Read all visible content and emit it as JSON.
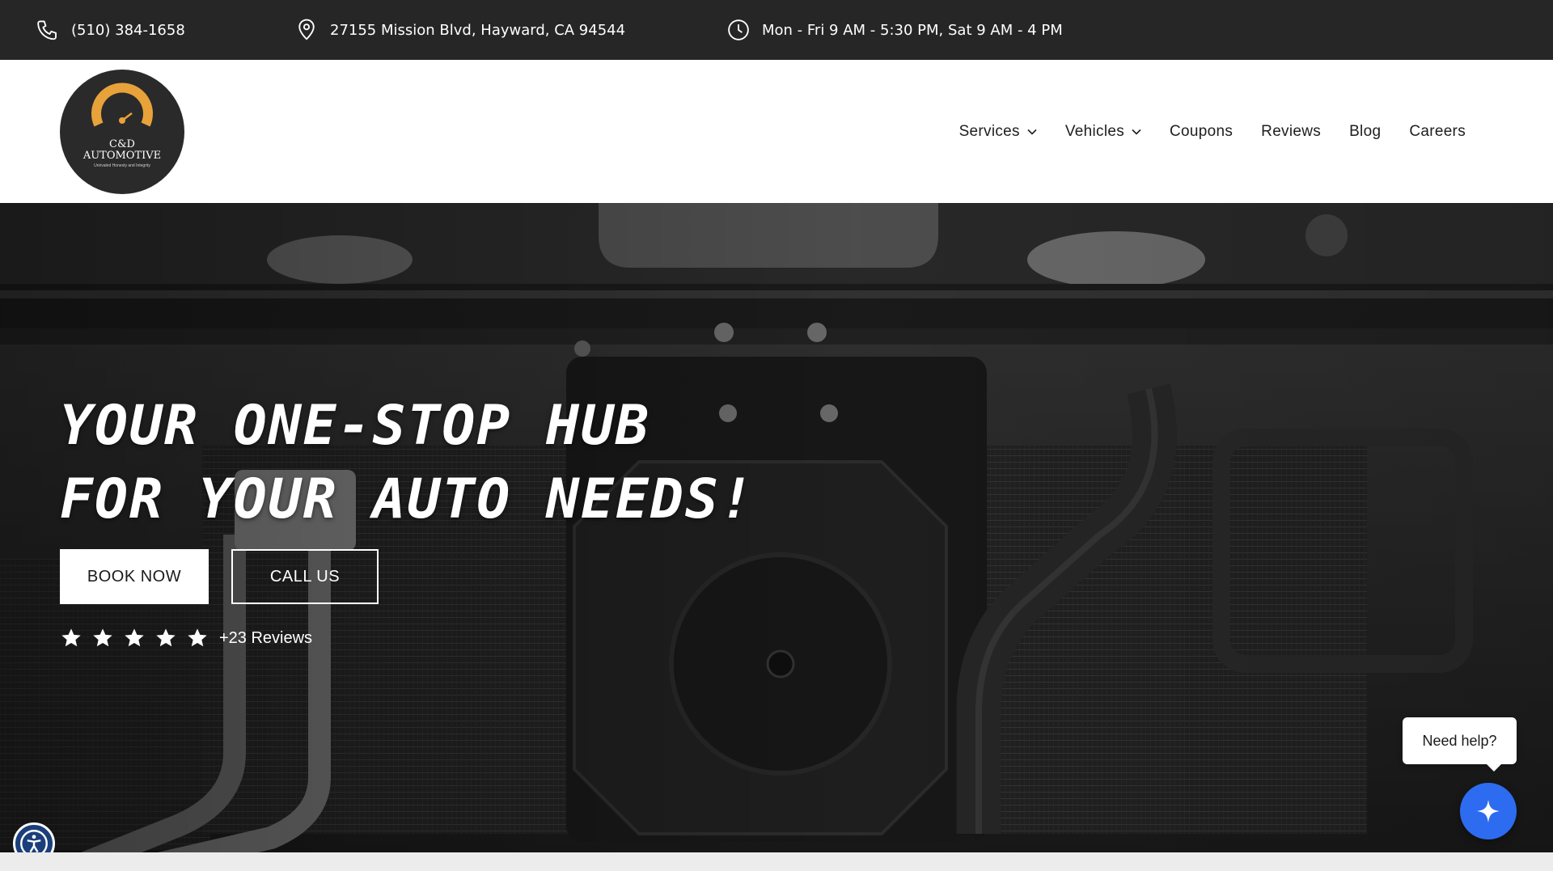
{
  "topbar": {
    "phone": "(510) 384-1658",
    "address": "27155 Mission Blvd, Hayward, CA 94544",
    "hours": "Mon - Fri 9 AM - 5:30 PM, Sat 9 AM - 4 PM"
  },
  "logo": {
    "line1": "C&D",
    "line2": "AUTOMOTIVE",
    "tagline": "Unrivaled Honesty and Integrity",
    "accent_color": "#e8a23a"
  },
  "nav": {
    "items": [
      {
        "label": "Services",
        "has_dropdown": true
      },
      {
        "label": "Vehicles",
        "has_dropdown": true
      },
      {
        "label": "Coupons",
        "has_dropdown": false
      },
      {
        "label": "Reviews",
        "has_dropdown": false
      },
      {
        "label": "Blog",
        "has_dropdown": false
      },
      {
        "label": "Careers",
        "has_dropdown": false
      }
    ]
  },
  "hero": {
    "headline_line1": "YOUR ONE-STOP HUB",
    "headline_line2": "FOR YOUR AUTO NEEDS!",
    "book_label": "BOOK NOW",
    "call_label": "CALL US",
    "stars": 5,
    "reviews_label": "+23 Reviews"
  },
  "chat": {
    "bubble_text": "Need help?",
    "button_color": "#2d6cf0",
    "icon": "sparkle-icon"
  },
  "accessibility": {
    "icon": "accessibility-icon",
    "color": "#1b3f7a"
  }
}
